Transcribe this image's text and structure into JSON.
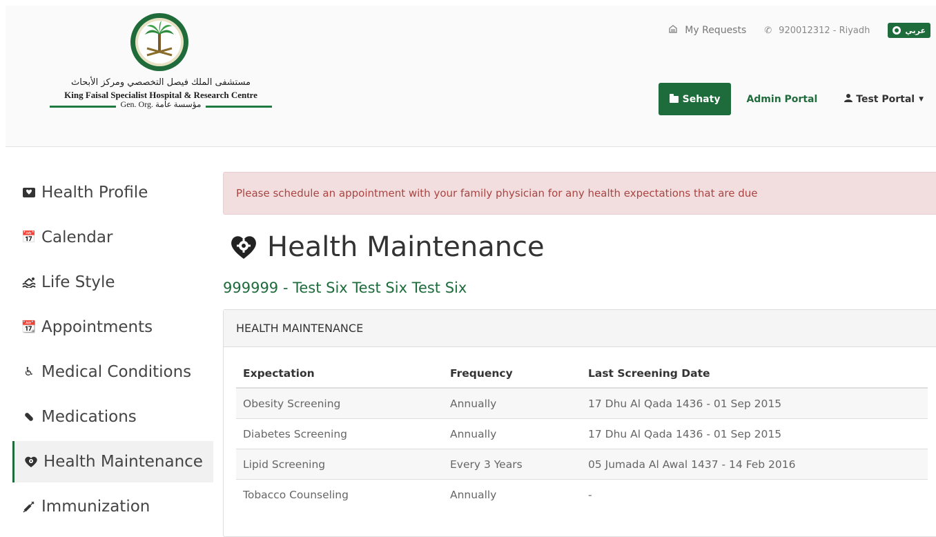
{
  "header": {
    "logo": {
      "arabic_name": "مستشفى الملك فيصل التخصصي ومركز الأبحاث",
      "english_name": "King Faisal Specialist Hospital & Research Centre",
      "gen_org": "Gen. Org. مؤسسة عامة"
    },
    "top_links": {
      "my_requests": "My Requests",
      "phone": "920012312 - Riyadh",
      "language": "عربي"
    },
    "nav": {
      "sehaty": "Sehaty",
      "admin_portal": "Admin Portal",
      "user_menu": "Test Portal"
    }
  },
  "sidebar": {
    "items": [
      {
        "label": "Health Profile",
        "icon": "id-card-icon"
      },
      {
        "label": "Calendar",
        "icon": "calendar-icon"
      },
      {
        "label": "Life Style",
        "icon": "swimming-icon"
      },
      {
        "label": "Appointments",
        "icon": "calendar-clock-icon"
      },
      {
        "label": "Medical Conditions",
        "icon": "wheelchair-icon"
      },
      {
        "label": "Medications",
        "icon": "pill-icon"
      },
      {
        "label": "Health Maintenance",
        "icon": "heart-gear-icon",
        "active": true
      },
      {
        "label": "Immunization",
        "icon": "syringe-icon"
      }
    ]
  },
  "main": {
    "alert": "Please schedule an appointment with your family physician for any health expectations that are due",
    "title": "Health Maintenance",
    "patient": "999999 - Test Six Test Six Test Six",
    "panel": {
      "heading": "HEALTH MAINTENANCE",
      "columns": [
        "Expectation",
        "Frequency",
        "Last Screening Date"
      ],
      "rows": [
        [
          "Obesity Screening",
          "Annually",
          "17 Dhu Al Qada 1436 - 01 Sep 2015"
        ],
        [
          "Diabetes Screening",
          "Annually",
          "17 Dhu Al Qada 1436 - 01 Sep 2015"
        ],
        [
          "Lipid Screening",
          "Every 3 Years",
          "05 Jumada Al Awal 1437 - 14 Feb 2016"
        ],
        [
          "Tobacco Counseling",
          "Annually",
          "-"
        ]
      ]
    }
  },
  "colors": {
    "brand_green": "#1e6b3b",
    "alert_bg": "#f2dede",
    "alert_text": "#a94442"
  }
}
